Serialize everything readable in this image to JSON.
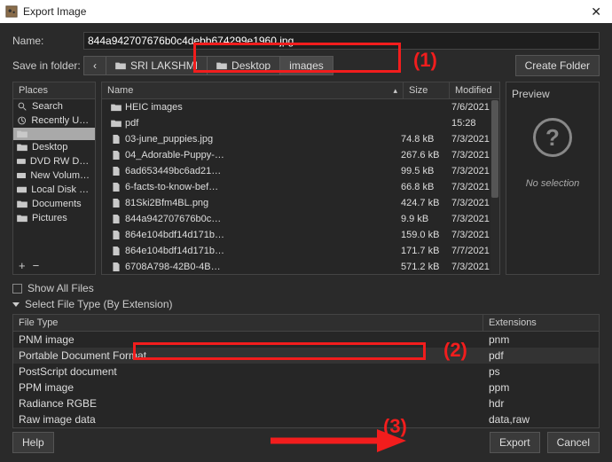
{
  "window": {
    "title": "Export Image"
  },
  "labels": {
    "name": "Name:",
    "save_in": "Save in folder:",
    "create_folder": "Create Folder"
  },
  "filename": {
    "full": "844a942707676b0c4debb674299e1960.jpg"
  },
  "breadcrumb": [
    {
      "label": "SRI LAKSHMI",
      "type": "folder"
    },
    {
      "label": "Desktop",
      "type": "folder"
    },
    {
      "label": "images",
      "type": "folder",
      "active": true
    }
  ],
  "columns": {
    "places": "Places",
    "name": "Name",
    "size": "Size",
    "modified": "Modified"
  },
  "places": [
    {
      "label": "Search",
      "icon": "search"
    },
    {
      "label": "Recently Used",
      "icon": "recent"
    },
    {
      "label": "",
      "icon": "folder",
      "selected": true
    },
    {
      "label": "Desktop",
      "icon": "folder"
    },
    {
      "label": "DVD RW Drive…",
      "icon": "disk"
    },
    {
      "label": "New Volume (…",
      "icon": "disk"
    },
    {
      "label": "Local Disk (C:)",
      "icon": "disk"
    },
    {
      "label": "Documents",
      "icon": "folder"
    },
    {
      "label": "Pictures",
      "icon": "folder"
    }
  ],
  "place_buttons": {
    "add": "+",
    "remove": "−"
  },
  "files": [
    {
      "name": "HEIC images",
      "icon": "folder",
      "size": "",
      "modified": "7/6/2021"
    },
    {
      "name": "pdf",
      "icon": "folder",
      "size": "",
      "modified": "15:28"
    },
    {
      "name": "03-june_puppies.jpg",
      "icon": "file",
      "size": "74.8 kB",
      "modified": "7/3/2021"
    },
    {
      "name": "04_Adorable-Puppy-…",
      "icon": "file",
      "size": "267.6 kB",
      "modified": "7/3/2021"
    },
    {
      "name": "6ad653449bc6ad21…",
      "icon": "file",
      "size": "99.5 kB",
      "modified": "7/3/2021"
    },
    {
      "name": "6-facts-to-know-bef…",
      "icon": "file",
      "size": "66.8 kB",
      "modified": "7/3/2021"
    },
    {
      "name": "81Ski2Bfm4BL.png",
      "icon": "file",
      "size": "424.7 kB",
      "modified": "7/3/2021"
    },
    {
      "name": "844a942707676b0c…",
      "icon": "file",
      "size": "9.9 kB",
      "modified": "7/3/2021"
    },
    {
      "name": "864e104bdf14d171b…",
      "icon": "file",
      "size": "159.0 kB",
      "modified": "7/3/2021"
    },
    {
      "name": "864e104bdf14d171b…",
      "icon": "file",
      "size": "171.7 kB",
      "modified": "7/7/2021"
    },
    {
      "name": "6708A798-42B0-4B…",
      "icon": "file",
      "size": "571.2 kB",
      "modified": "7/3/2021"
    }
  ],
  "preview": {
    "header": "Preview",
    "no_selection": "No selection"
  },
  "filetype": {
    "show_all": "Show All Files",
    "select_by_ext": "Select File Type (By Extension)",
    "col_type": "File Type",
    "col_ext": "Extensions",
    "rows": [
      {
        "type": "PNM image",
        "ext": "pnm"
      },
      {
        "type": "Portable Document Format",
        "ext": "pdf",
        "selected": true
      },
      {
        "type": "PostScript document",
        "ext": "ps"
      },
      {
        "type": "PPM image",
        "ext": "ppm"
      },
      {
        "type": "Radiance RGBE",
        "ext": "hdr"
      },
      {
        "type": "Raw image data",
        "ext": "data,raw"
      }
    ]
  },
  "footer": {
    "help": "Help",
    "export": "Export",
    "cancel": "Cancel"
  },
  "annotations": {
    "n1": "(1)",
    "n2": "(2)",
    "n3": "(3)"
  }
}
